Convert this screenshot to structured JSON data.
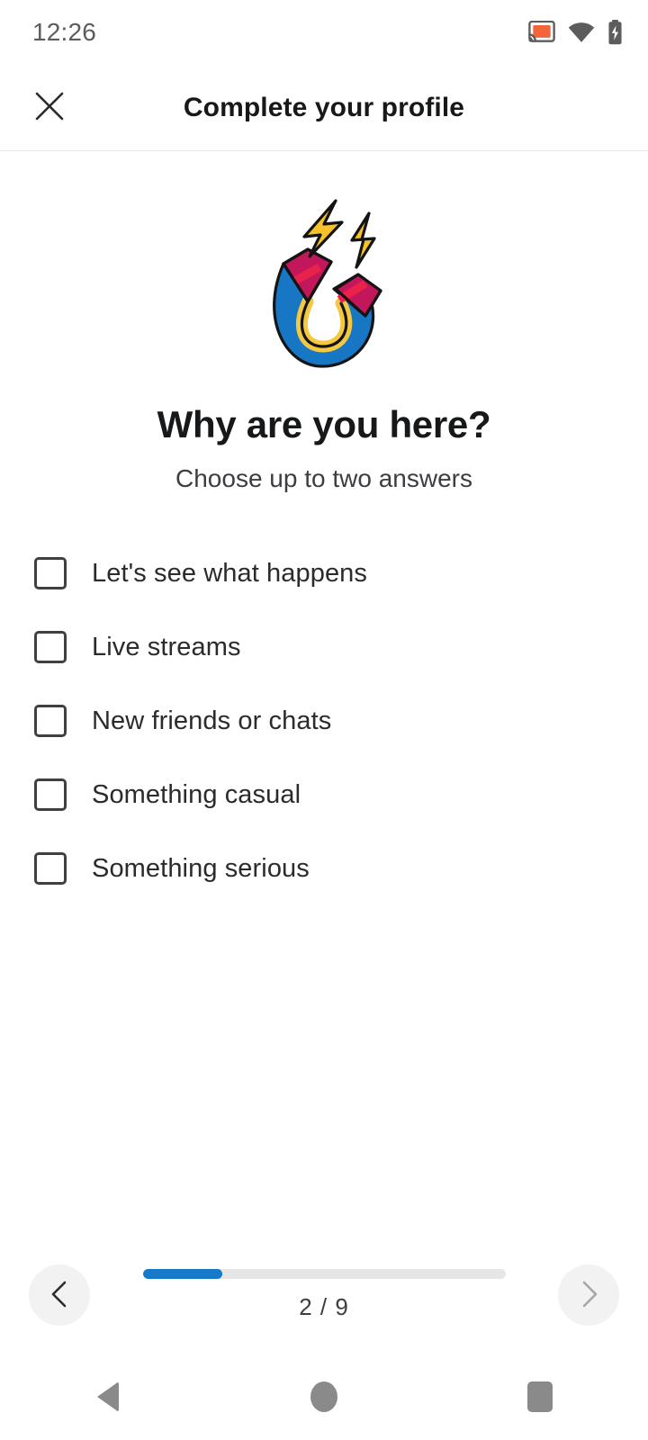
{
  "status_bar": {
    "time": "12:26",
    "icons": [
      "cast-icon",
      "wifi-icon",
      "battery-charging-icon"
    ],
    "cast_accent_color": "#f2653a",
    "icon_color": "#5c5c5c"
  },
  "header": {
    "title": "Complete your profile",
    "close_icon": "close-icon"
  },
  "illustration": {
    "name": "magnet-illustration",
    "magnet_body_color": "#1877c4",
    "magnet_tip_color": "#c2185b",
    "magnet_inner_color": "#f5c842",
    "bolt_color": "#f5c22b",
    "outline_color": "#141414"
  },
  "question": {
    "title": "Why are you here?",
    "subtitle": "Choose up to two answers"
  },
  "options": [
    {
      "label": "Let's see what happens",
      "checked": false
    },
    {
      "label": "Live streams",
      "checked": false
    },
    {
      "label": "New friends or chats",
      "checked": false
    },
    {
      "label": "Something casual",
      "checked": false
    },
    {
      "label": "Something serious",
      "checked": false
    }
  ],
  "footer": {
    "back_icon": "chevron-left-icon",
    "forward_icon": "chevron-right-icon",
    "progress_text": "2 / 9",
    "progress_current": 2,
    "progress_total": 9,
    "progress_percent": 22,
    "progress_fill_color": "#1878c9",
    "progress_track_color": "#e6e6e6",
    "back_enabled": true,
    "forward_enabled": false
  },
  "android_nav": {
    "back": "android-back-icon",
    "home": "android-home-icon",
    "recents": "android-recents-icon",
    "color": "#8a8a8a"
  }
}
